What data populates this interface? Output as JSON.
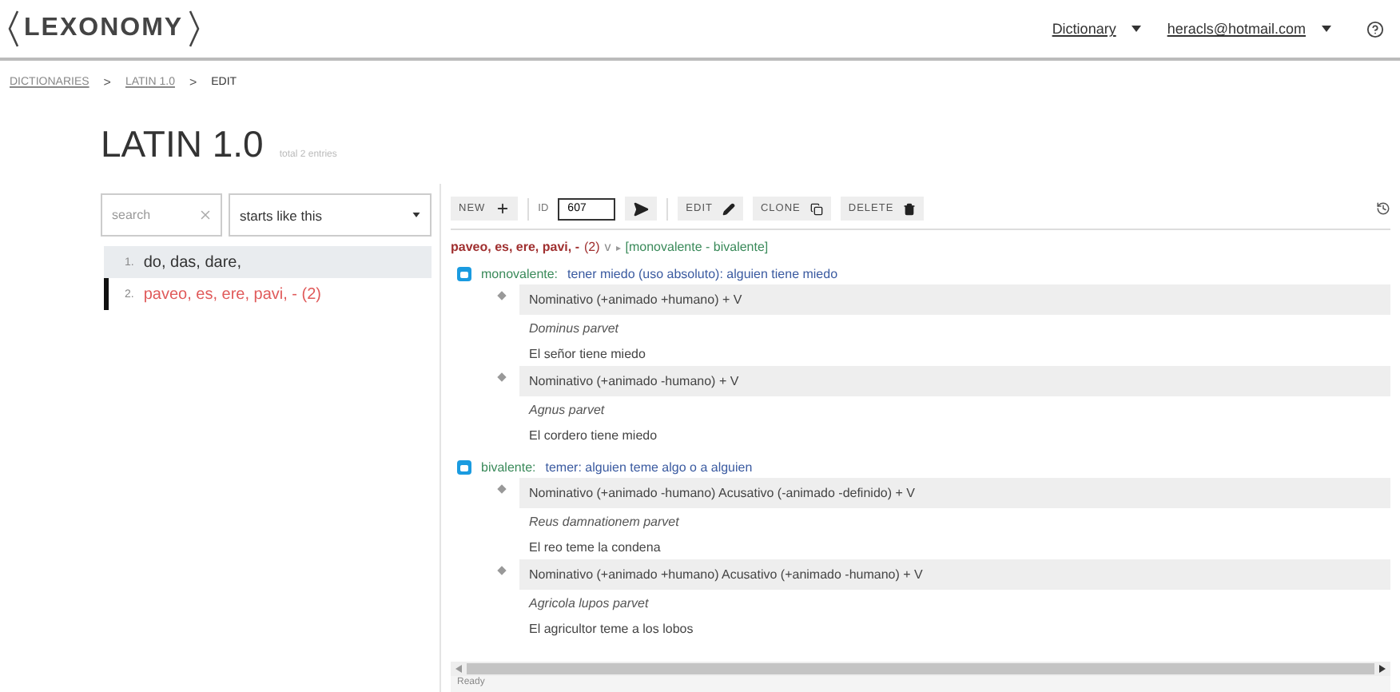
{
  "header": {
    "logo": "LEXONOMY",
    "menus": [
      {
        "label": "Dictionary"
      },
      {
        "label": "heracls@hotmail.com"
      }
    ]
  },
  "breadcrumb": {
    "separator": ">",
    "items": [
      {
        "label": "DICTIONARIES",
        "link": true
      },
      {
        "label": "LATIN 1.0",
        "link": true
      },
      {
        "label": "EDIT",
        "link": false
      }
    ]
  },
  "title": "LATIN 1.0",
  "subtitle": "total 2 entries",
  "search": {
    "placeholder": "search",
    "mode": "starts like this"
  },
  "entries": [
    {
      "number": "1.",
      "label": "do, das, dare,",
      "selected": false,
      "hovered": true
    },
    {
      "number": "2.",
      "label": "paveo, es, ere, pavi, - (2)",
      "selected": true,
      "hovered": false
    }
  ],
  "toolbar": {
    "new": "NEW",
    "id_label": "ID",
    "id_value": "607",
    "edit": "EDIT",
    "clone": "CLONE",
    "delete": "DELETE"
  },
  "entry": {
    "headword": "paveo, es, ere, pavi, -",
    "homograph": "(2)",
    "pos": "v",
    "arrow": "▸",
    "valency": "[monovalente - bivalente]",
    "senses": [
      {
        "label": "monovalente:",
        "definition": "tener miedo (uso absoluto): alguien tiene miedo",
        "patterns": [
          {
            "pattern": "Nominativo (+animado +humano) + V",
            "example": "Dominus parvet",
            "translation": "El señor tiene miedo"
          },
          {
            "pattern": "Nominativo (+animado -humano) + V",
            "example": "Agnus parvet",
            "translation": "El cordero tiene miedo"
          }
        ]
      },
      {
        "label": "bivalente:",
        "definition": "temer: alguien teme algo o a alguien",
        "patterns": [
          {
            "pattern": "Nominativo (+animado -humano) Acusativo (-animado -definido) + V",
            "example": "Reus damnationem parvet",
            "translation": "El reo teme la condena"
          },
          {
            "pattern": "Nominativo (+animado +humano) Acusativo (+animado -humano) + V",
            "example": "Agricola lupos parvet",
            "translation": "El agricultor teme a los lobos"
          }
        ]
      }
    ]
  },
  "status": "Ready"
}
